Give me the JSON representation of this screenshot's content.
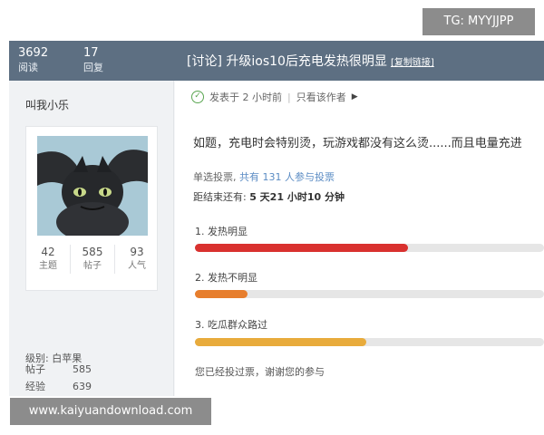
{
  "header": {
    "replies_count": "3692",
    "replies_label": "阅读",
    "reply_count": "17",
    "reply_label": "回复",
    "title": "[讨论] 升级ios10后充电发热很明显",
    "copy_link": "[复制链接]"
  },
  "sidebar": {
    "username": "叫我小乐",
    "stats": [
      {
        "value": "42",
        "label": "主题"
      },
      {
        "value": "585",
        "label": "帖子"
      },
      {
        "value": "93",
        "label": "人气"
      }
    ],
    "level": "级别: 白苹果",
    "meta": [
      {
        "key": "帖子",
        "value": "585"
      },
      {
        "key": "经验",
        "value": "639"
      }
    ]
  },
  "post": {
    "posted": "发表于 2 小时前",
    "only_author": "只看该作者",
    "body": "如题，充电时会特别烫，玩游戏都没有这么烫......而且电量充进",
    "poll_type": "单选投票,",
    "poll_total": "共有 131 人参与投票",
    "deadline_label": "距结束还有: ",
    "deadline_value": "5 天21 小时10 分钟",
    "options": [
      {
        "label": "1.  发热明显",
        "fraction": 0.61,
        "color": "#d9312f"
      },
      {
        "label": "2.  发热不明显",
        "fraction": 0.15,
        "color": "#e77e2d"
      },
      {
        "label": "3.  吃瓜群众路过",
        "fraction": 0.49,
        "color": "#e8ab3c"
      }
    ],
    "voted_text": "您已经投过票，谢谢您的参与"
  },
  "watermarks": {
    "top": "TG: MYYJJPP",
    "bottom": "www.kaiyuandownload.com"
  }
}
